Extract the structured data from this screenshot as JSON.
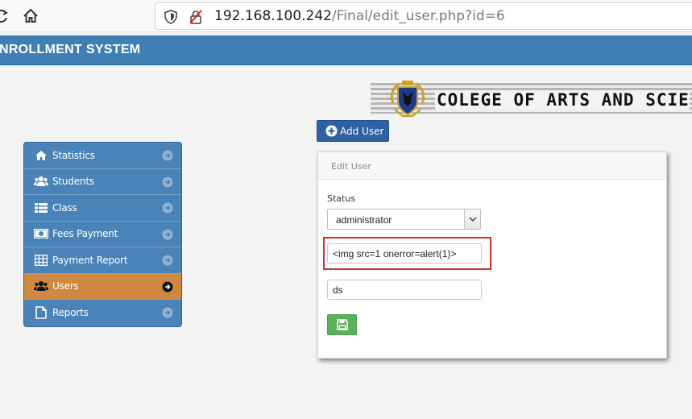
{
  "browser": {
    "url_host": "192.168.100.242",
    "url_path": "/Final/edit_user.php?id=6",
    "icons": [
      "reload-icon",
      "home-icon",
      "shield-icon",
      "insecure-lock-icon"
    ]
  },
  "app": {
    "title": "ENROLLMENT SYSTEM"
  },
  "banner": {
    "text": "COLEGE OF ARTS AND SCIE"
  },
  "sidebar": {
    "items": [
      {
        "label": "Statistics",
        "icon": "home-icon",
        "active": false
      },
      {
        "label": "Students",
        "icon": "users-icon",
        "active": false
      },
      {
        "label": "Class",
        "icon": "list-icon",
        "active": false
      },
      {
        "label": "Fees Payment",
        "icon": "money-icon",
        "active": false
      },
      {
        "label": "Payment Report",
        "icon": "table-icon",
        "active": false
      },
      {
        "label": "Users",
        "icon": "users-icon",
        "active": true
      },
      {
        "label": "Reports",
        "icon": "file-icon",
        "active": false
      }
    ]
  },
  "toolbar": {
    "add_user_label": "Add User"
  },
  "panel": {
    "heading": "Edit User",
    "status_label": "Status",
    "status_value": "administrator",
    "field1_value": "<img src=1 onerror=alert(1)>",
    "field2_value": "ds"
  },
  "colors": {
    "header_blue": "#3f7fb6",
    "sidebar_blue": "#4a83b7",
    "active_orange": "#cf8842",
    "add_button": "#2f61a3",
    "save_green": "#5cb25c",
    "highlight_red": "#d0312d"
  }
}
